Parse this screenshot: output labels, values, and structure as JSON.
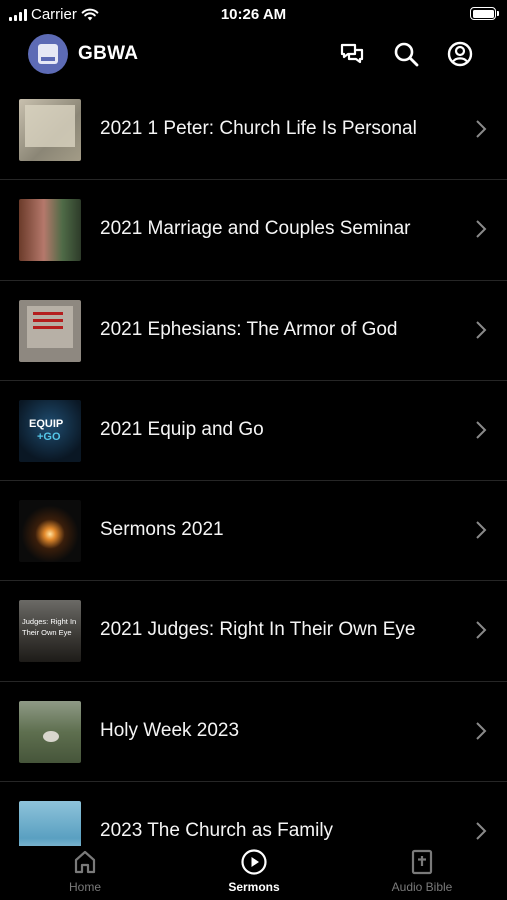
{
  "status_bar": {
    "carrier": "Carrier",
    "time": "10:26 AM"
  },
  "header": {
    "app_title": "GBWA",
    "icons": [
      "chat-icon",
      "search-icon",
      "account-icon"
    ]
  },
  "sermon_series": [
    {
      "title": "2021 1 Peter: Church Life Is Personal",
      "thumb_text": ""
    },
    {
      "title": "2021 Marriage and Couples Seminar",
      "thumb_text": ""
    },
    {
      "title": "2021 Ephesians:  The Armor of God",
      "thumb_text": ""
    },
    {
      "title": "2021 Equip and Go",
      "thumb_text": "EQUIP +GO"
    },
    {
      "title": "Sermons 2021",
      "thumb_text": ""
    },
    {
      "title": "2021 Judges: Right In Their Own Eye",
      "thumb_text": "Judges: Right In Their Own Eye"
    },
    {
      "title": "Holy Week 2023",
      "thumb_text": ""
    },
    {
      "title": "2023 The Church as Family",
      "thumb_text": ""
    }
  ],
  "tabbar": {
    "tabs": [
      {
        "label": "Home",
        "icon": "home-icon",
        "active": false
      },
      {
        "label": "Sermons",
        "icon": "play-circle-icon",
        "active": true
      },
      {
        "label": "Audio Bible",
        "icon": "bible-icon",
        "active": false
      }
    ]
  }
}
